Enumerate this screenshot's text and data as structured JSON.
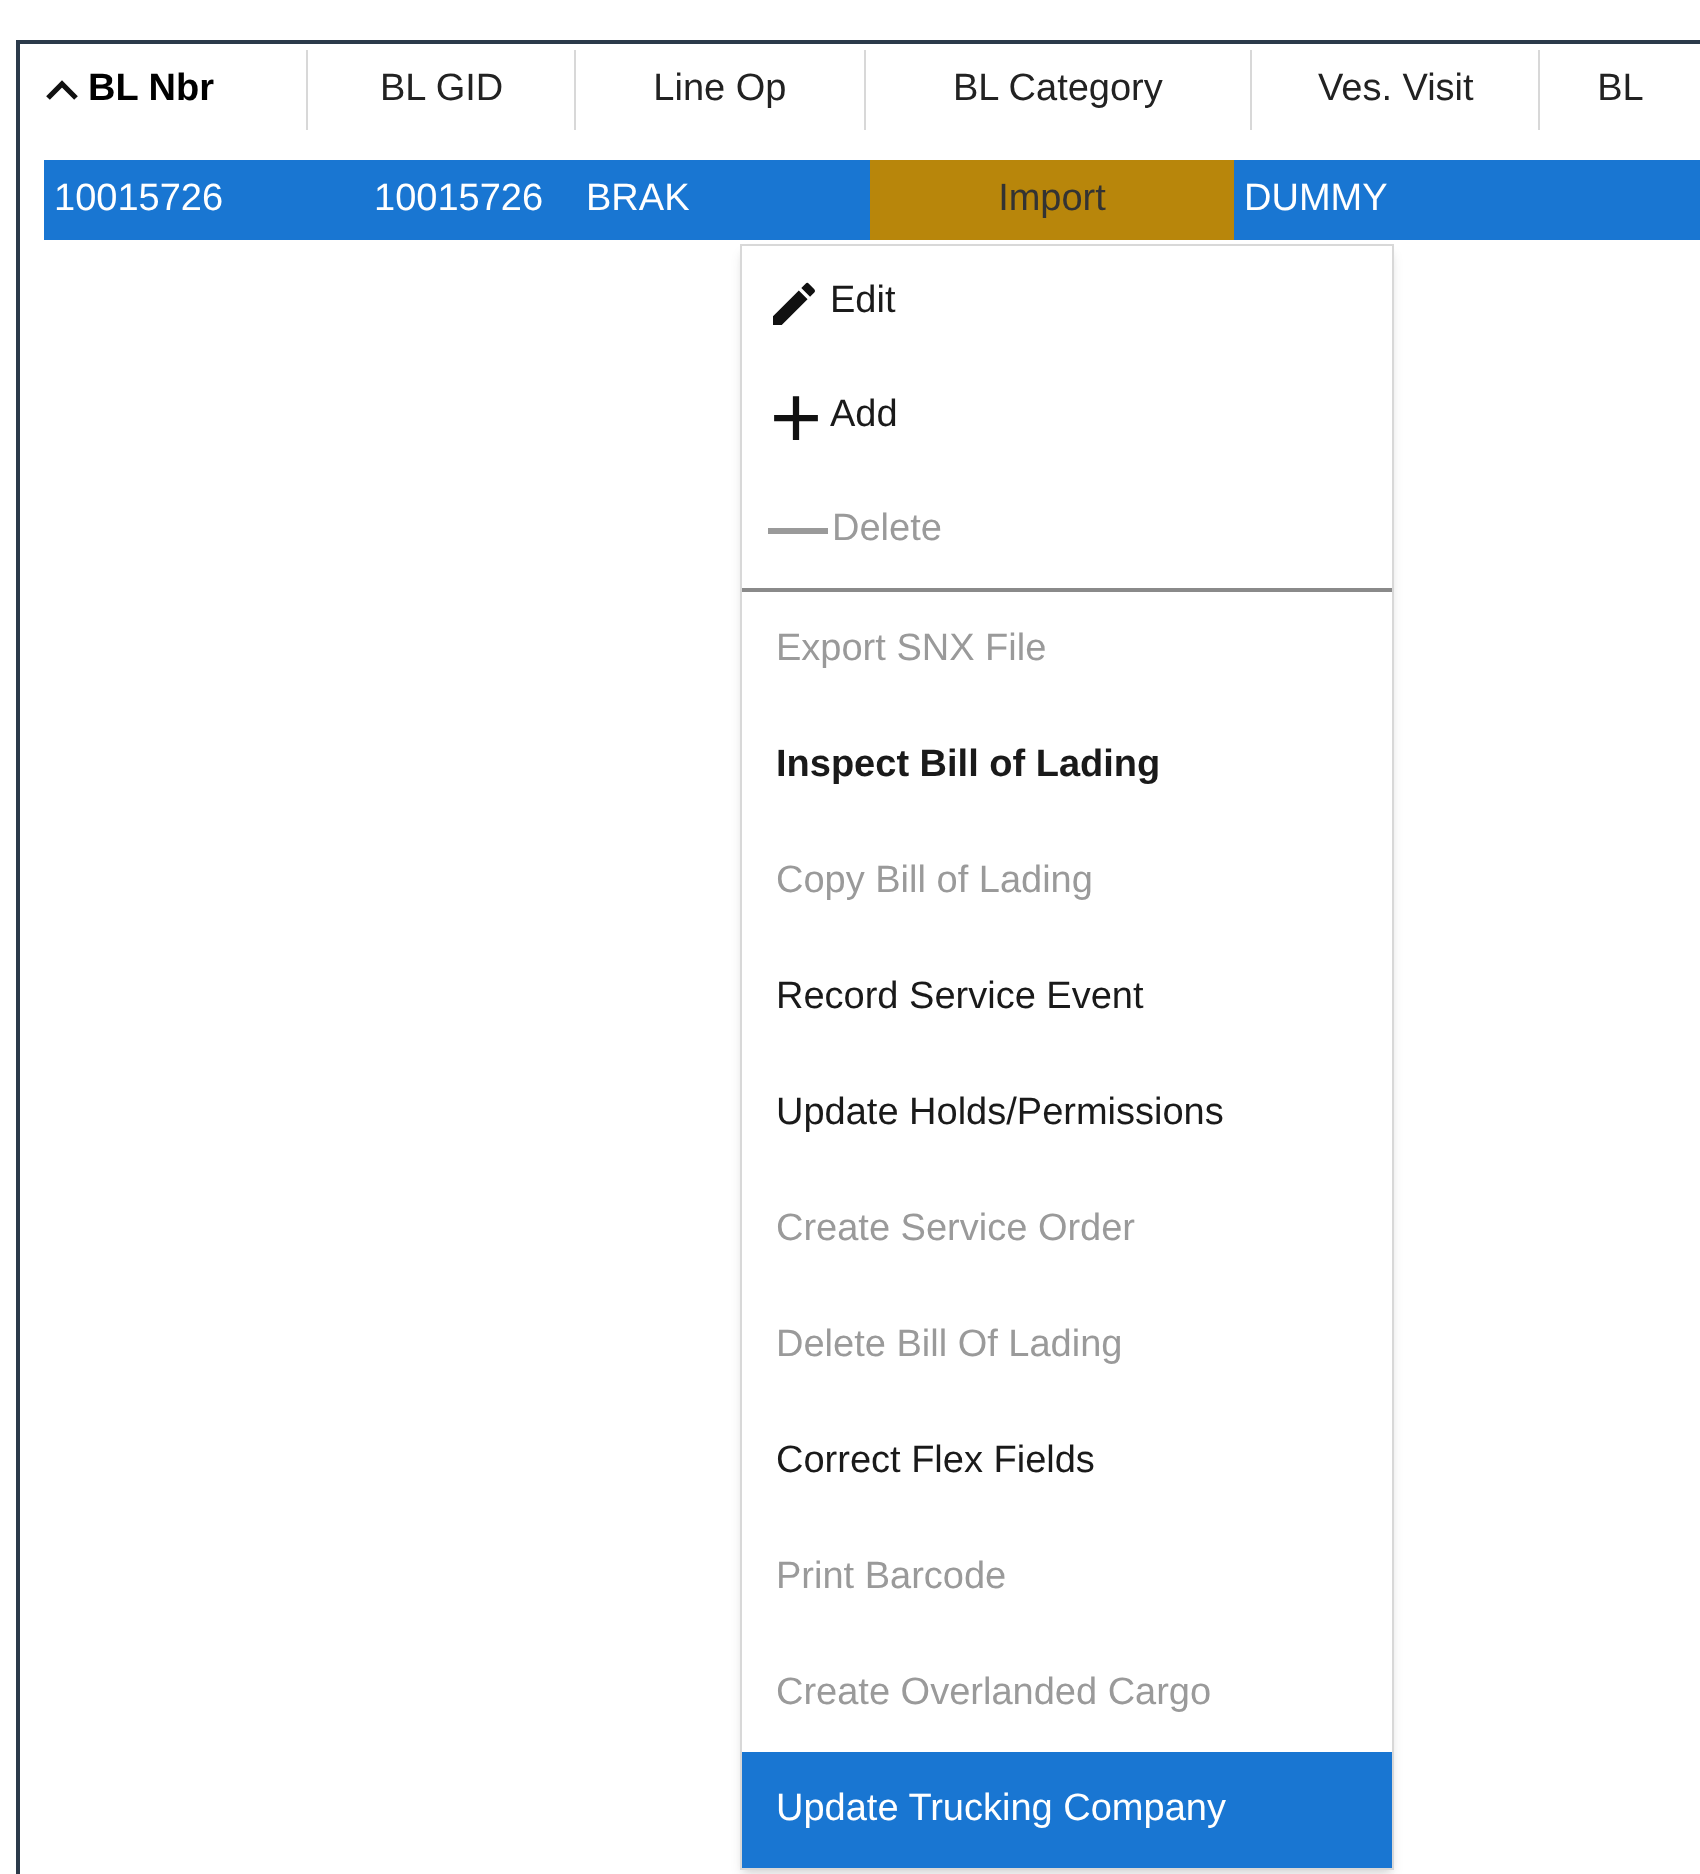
{
  "table": {
    "columns": [
      {
        "label": "BL Nbr",
        "sorted": true
      },
      {
        "label": "BL GID",
        "sorted": false
      },
      {
        "label": "Line Op",
        "sorted": false
      },
      {
        "label": "BL Category",
        "sorted": false
      },
      {
        "label": "Ves. Visit",
        "sorted": false
      },
      {
        "label": "BL",
        "sorted": false
      }
    ],
    "rows": [
      {
        "selected": true,
        "cells": [
          "10015726",
          "10015726",
          "BRAK",
          "Import",
          "DUMMY"
        ]
      }
    ]
  },
  "context_menu": {
    "groups": [
      [
        {
          "label": "Edit",
          "kind": "pencil",
          "disabled": false,
          "bold": false,
          "selected": false
        },
        {
          "label": "Add",
          "kind": "plus",
          "disabled": false,
          "bold": false,
          "selected": false
        },
        {
          "label": "Delete",
          "kind": "minus",
          "disabled": true,
          "bold": false,
          "selected": false
        }
      ],
      [
        {
          "label": "Export SNX File",
          "kind": "text",
          "disabled": true,
          "bold": false,
          "selected": false
        },
        {
          "label": "Inspect Bill of Lading",
          "kind": "text",
          "disabled": false,
          "bold": true,
          "selected": false
        },
        {
          "label": "Copy Bill of Lading",
          "kind": "text",
          "disabled": true,
          "bold": false,
          "selected": false
        },
        {
          "label": "Record Service Event",
          "kind": "text",
          "disabled": false,
          "bold": false,
          "selected": false
        },
        {
          "label": "Update Holds/Permissions",
          "kind": "text",
          "disabled": false,
          "bold": false,
          "selected": false
        },
        {
          "label": "Create Service Order",
          "kind": "text",
          "disabled": true,
          "bold": false,
          "selected": false
        },
        {
          "label": "Delete Bill Of Lading",
          "kind": "text",
          "disabled": true,
          "bold": false,
          "selected": false
        },
        {
          "label": "Correct Flex Fields",
          "kind": "text",
          "disabled": false,
          "bold": false,
          "selected": false
        },
        {
          "label": "Print Barcode",
          "kind": "text",
          "disabled": true,
          "bold": false,
          "selected": false
        },
        {
          "label": "Create Overlanded Cargo",
          "kind": "text",
          "disabled": true,
          "bold": false,
          "selected": false
        },
        {
          "label": "Update Trucking Company",
          "kind": "text",
          "disabled": false,
          "bold": false,
          "selected": true
        }
      ]
    ]
  }
}
